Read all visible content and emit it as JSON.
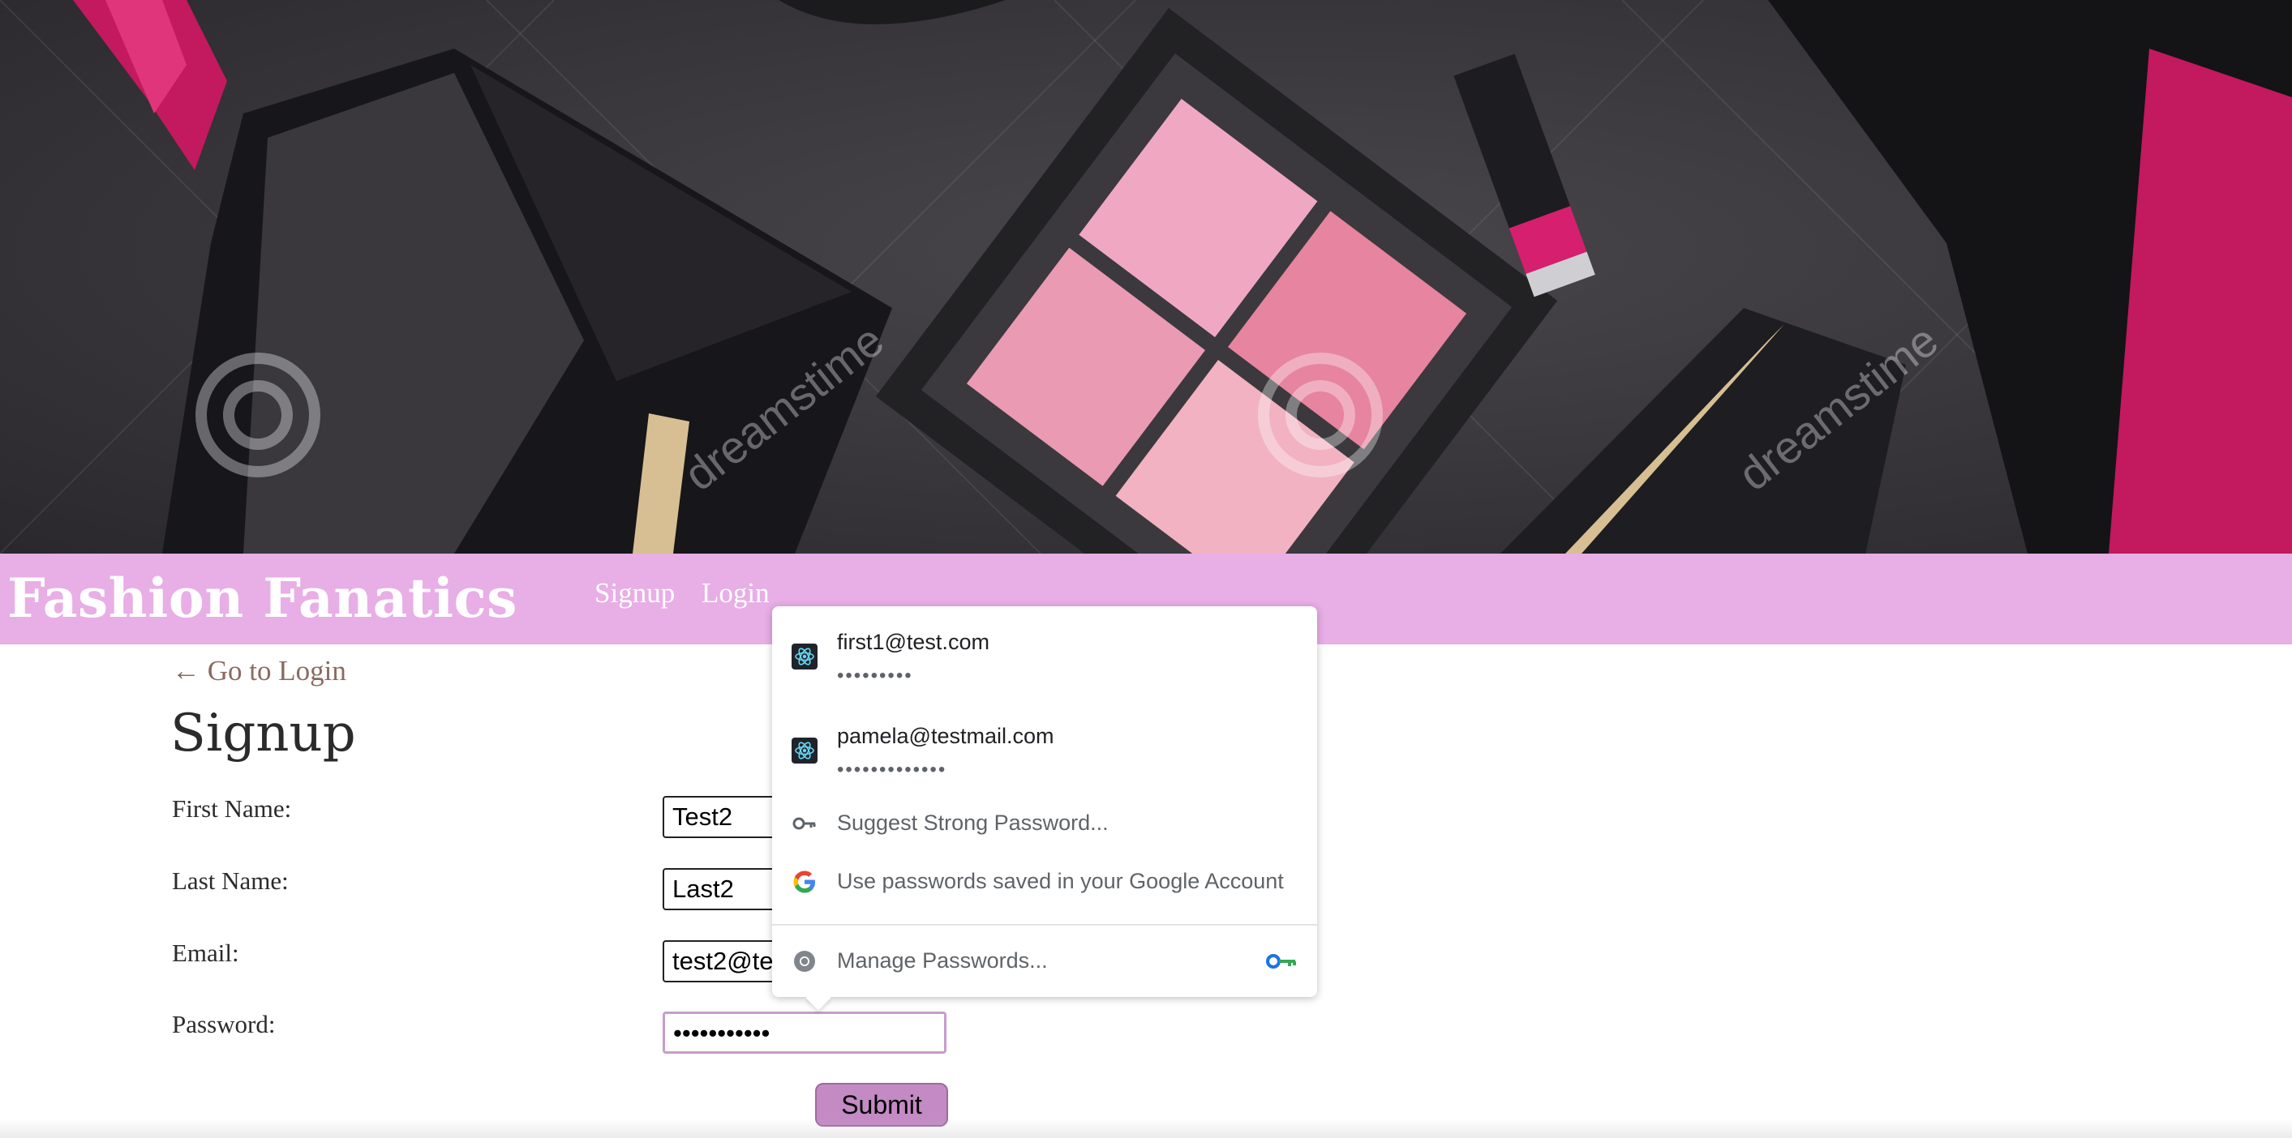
{
  "hero": {
    "watermark_text": "dreamstime"
  },
  "nav": {
    "brand": "Fashion Fanatics",
    "links": [
      {
        "label": "Signup"
      },
      {
        "label": "Login"
      }
    ]
  },
  "page": {
    "back_link": "← Go to Login",
    "title": "Signup"
  },
  "form": {
    "fields": [
      {
        "label": "First Name:",
        "value": "Test2"
      },
      {
        "label": "Last Name:",
        "value": "Last2"
      },
      {
        "label": "Email:",
        "value": "test2@te"
      },
      {
        "label": "Password:",
        "value": "•••••••••••"
      }
    ],
    "submit_label": "Submit"
  },
  "autofill": {
    "accounts": [
      {
        "username": "first1@test.com",
        "masked_password": "•••••••••",
        "icon": "react-icon"
      },
      {
        "username": "pamela@testmail.com",
        "masked_password": "•••••••••••••",
        "icon": "react-icon"
      }
    ],
    "suggest_strong": "Suggest Strong Password...",
    "google_account": "Use passwords saved in your Google Account",
    "manage": "Manage Passwords...",
    "icons": {
      "suggest": "key-icon",
      "google": "google-icon",
      "manage": "chrome-icon",
      "manage_trailing": "password-key-icon"
    }
  },
  "colors": {
    "navbar": "#e8aee6",
    "submit": "#c48ac4",
    "focus_border": "#c79ccd",
    "back_link": "#8a6a60"
  }
}
